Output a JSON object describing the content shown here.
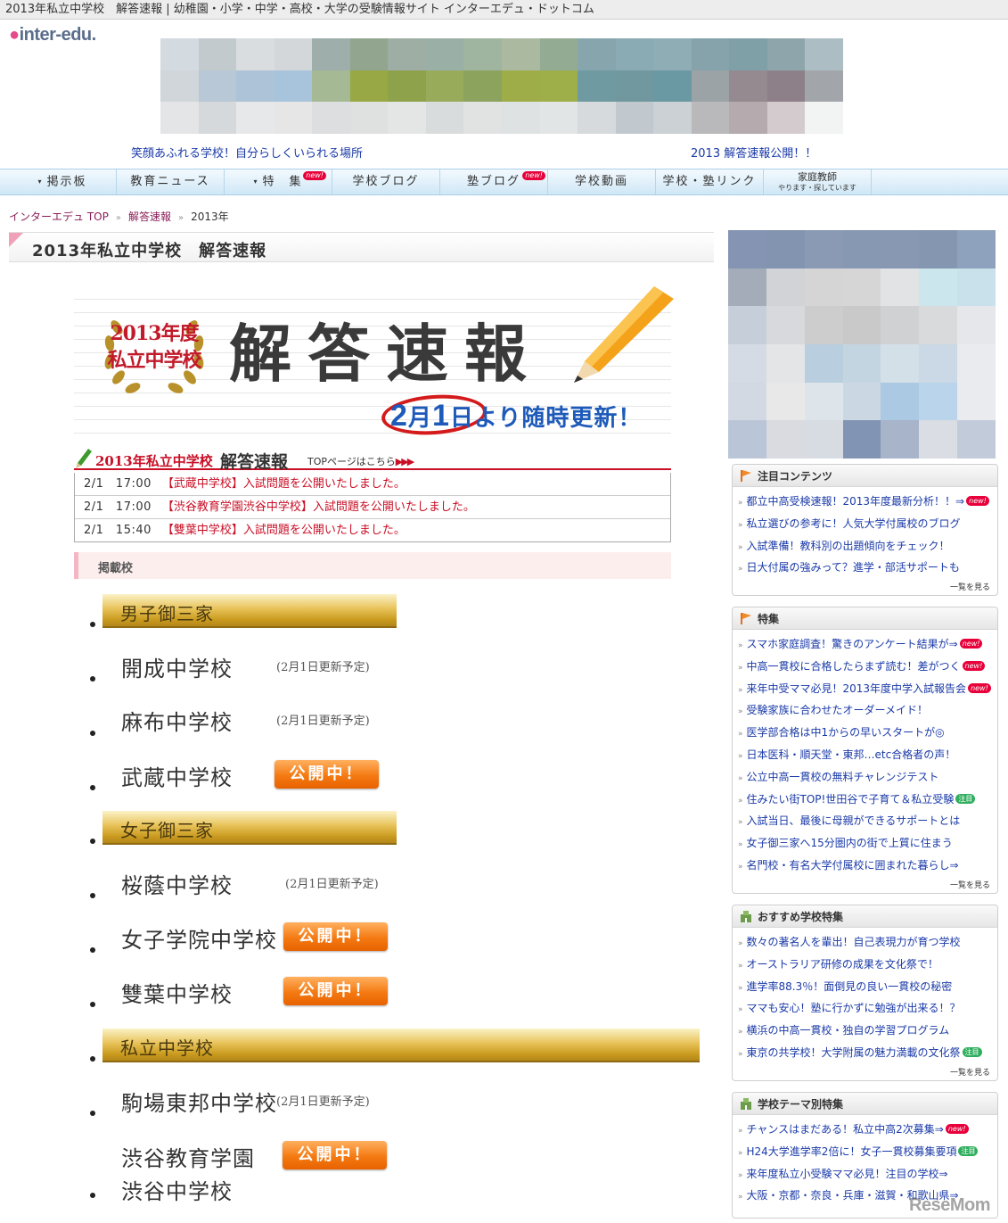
{
  "window": {
    "title": "2013年私立中学校　解答速報 | 幼稚園・小学・中学・高校・大学の受験情報サイト インターエデュ・ドットコム"
  },
  "logo": {
    "text": "inter-edu."
  },
  "banner": {
    "tagline_left": "笑顔あふれる学校！自分らしくいられる場所",
    "tagline_right": "2013 解答速報公開！！",
    "colors": [
      "#d4dbe0",
      "#c3cace",
      "#d9dddf",
      "#d3d7d9",
      "#9eaeab",
      "#92a58f",
      "#9eaea4",
      "#9aafa6",
      "#a0b5a0",
      "#aab9a0",
      "#93aa93",
      "#86a5ad",
      "#8aaab4",
      "#8eadb4",
      "#86a2aa",
      "#7fa0a6",
      "#8ea6ab",
      "#acbec3",
      "#d0d6da",
      "#b8c8d6",
      "#adc3d7",
      "#a8c4dc",
      "#a5b994",
      "#98a844",
      "#8da24a",
      "#98ab5a",
      "#8ba35c",
      "#9ead48",
      "#9eae48",
      "#6f9aa2",
      "#71989e",
      "#6a98a3",
      "#9ba3a6",
      "#948a90",
      "#8e8089",
      "#a2a6ab",
      "#e3e5e6",
      "#d5d9dc",
      "#e6e8ea",
      "#e6e6e6",
      "#dcdee0",
      "#dfe0e0",
      "#e4e5e5",
      "#d9dcdd",
      "#e1e2e2",
      "#dfe2e3",
      "#e2e5e6",
      "#d6dadc",
      "#c1c9cf",
      "#cbd1d4",
      "#b9b8bb",
      "#b5aaae",
      "#d4cbce",
      "#f2f3f3"
    ]
  },
  "nav": {
    "items": [
      {
        "label": "掲示板",
        "arrow": "▾",
        "badge": ""
      },
      {
        "label": "教育ニュース",
        "arrow": "",
        "badge": ""
      },
      {
        "label": "特　集",
        "arrow": "▾",
        "badge": "new!"
      },
      {
        "label": "学校ブログ",
        "arrow": "",
        "badge": ""
      },
      {
        "label": "塾ブログ",
        "arrow": "",
        "badge": "new!"
      },
      {
        "label": "学校動画",
        "arrow": "",
        "badge": ""
      },
      {
        "label": "学校・塾リンク",
        "arrow": "",
        "badge": ""
      }
    ],
    "tutor": {
      "label": "家庭教師",
      "sub": "やります・探しています"
    }
  },
  "breadcrumb": {
    "items": [
      "インターエデュ TOP",
      "解答速報",
      "2013年"
    ],
    "sep": "»"
  },
  "page": {
    "title": "2013年私立中学校　解答速報"
  },
  "hero": {
    "badge_line1": "2013年度",
    "badge_line2": "私立中学校",
    "title": "解答速報",
    "update_date": "2月1日",
    "update_big1": "2",
    "update_mid": "月",
    "update_big2": "1",
    "update_end": "日",
    "update_text": "より随時更新！"
  },
  "news": {
    "head_red": "2013年私立中学校",
    "head_black": "解答速報",
    "top_link": "TOPページはこちら",
    "top_arrows": "▶▶▶",
    "rows": [
      {
        "date": "2/1　17:00",
        "text": "【武蔵中学校】入試問題を公開いたしました。"
      },
      {
        "date": "2/1　17:00",
        "text": "【渋谷教育学園渋谷中学校】入試問題を公開いたしました。"
      },
      {
        "date": "2/1　15:40",
        "text": "【雙葉中学校】入試問題を公開いたしました。"
      }
    ]
  },
  "schools_section": {
    "label": "掲載校"
  },
  "categories": [
    {
      "label": "男子御三家"
    },
    {
      "label": "女子御三家"
    },
    {
      "label": "私立中学校"
    }
  ],
  "schools": [
    {
      "name": "開成中学校",
      "status": "(2月1日更新予定)"
    },
    {
      "name": "麻布中学校",
      "status": "(2月1日更新予定)"
    },
    {
      "name": "武蔵中学校",
      "status": "公開中！"
    },
    {
      "name": "桜蔭中学校",
      "status": "(2月1日更新予定)"
    },
    {
      "name": "女子学院中学校",
      "status": "公開中！"
    },
    {
      "name": "雙葉中学校",
      "status": "公開中！"
    },
    {
      "name": "駒場東邦中学校",
      "status": "(2月1日更新予定)"
    },
    {
      "name": "渋谷教育学園",
      "name2": "渋谷中学校",
      "status": "公開中！"
    }
  ],
  "side_ad": {
    "colors": [
      "#8494b2",
      "#8394b0",
      "#8a9ab5",
      "#8798b3",
      "#8898b3",
      "#8596b1",
      "#8fa2bd",
      "#a5acb9",
      "#d2d3d6",
      "#d5d5d6",
      "#d6d6d7",
      "#e1e3e4",
      "#cbe6ec",
      "#c8e1ea",
      "#c6ced9",
      "#d8d9dc",
      "#cdcdce",
      "#c9c9ca",
      "#d0d1d2",
      "#d9dadc",
      "#e6e7ea",
      "#d5dbe4",
      "#e4e5e6",
      "#b9cfdf",
      "#c4d5e2",
      "#d3e0e8",
      "#cad9e5",
      "#e9ebee",
      "#d2d9e3",
      "#e8e8e9",
      "#dde4ea",
      "#cbd8e4",
      "#abc9e2",
      "#b9d4eb",
      "#eaebee",
      "#bac6d8",
      "#d9dbe1",
      "#d7dce3",
      "#8294b4",
      "#a7b4c9",
      "#dadde4",
      "#c2cbda"
    ]
  },
  "panels": [
    {
      "title": "注目コンテンツ",
      "more": "一覧を見る",
      "items": [
        {
          "text": "都立中高受検速報！2013年度最新分析！！⇒",
          "badge": "new!"
        },
        {
          "text": "私立選びの参考に！人気大学付属校のブログ",
          "badge": ""
        },
        {
          "text": "入試準備！教科別の出題傾向をチェック！",
          "badge": ""
        },
        {
          "text": "日大付属の強みって？進学・部活サポートも",
          "badge": ""
        }
      ]
    },
    {
      "title": "特集",
      "more": "一覧を見る",
      "items": [
        {
          "text": "スマホ家庭調査！驚きのアンケート結果が⇒",
          "badge": "new!"
        },
        {
          "text": "中高一貫校に合格したらまず読む！差がつく",
          "badge": "new!"
        },
        {
          "text": "来年中受ママ必見！2013年度中学入試報告会",
          "badge": "new!"
        },
        {
          "text": "受験家族に合わせたオーダーメイド！",
          "badge": ""
        },
        {
          "text": "医学部合格は中1からの早いスタートが◎",
          "badge": ""
        },
        {
          "text": "日本医科・順天堂・東邦…etc合格者の声！",
          "badge": ""
        },
        {
          "text": "公立中高一貫校の無料チャレンジテスト",
          "badge": ""
        },
        {
          "text": "住みたい街TOP!世田谷で子育て＆私立受験",
          "badge": "注目"
        },
        {
          "text": "入試当日、最後に母親ができるサポートとは",
          "badge": ""
        },
        {
          "text": "女子御三家へ15分圏内の街で上質に住まう",
          "badge": ""
        },
        {
          "text": "名門校・有名大学付属校に囲まれた暮らし⇒",
          "badge": ""
        }
      ]
    },
    {
      "title": "おすすめ学校特集",
      "more": "一覧を見る",
      "items": [
        {
          "text": "数々の著名人を輩出！自己表現力が育つ学校",
          "badge": ""
        },
        {
          "text": "オーストラリア研修の成果を文化祭で！",
          "badge": ""
        },
        {
          "text": "進学率88.3％！面倒見の良い一貫校の秘密",
          "badge": ""
        },
        {
          "text": "ママも安心！塾に行かずに勉強が出来る！？",
          "badge": ""
        },
        {
          "text": "横浜の中高一貫校・独自の学習プログラム",
          "badge": ""
        },
        {
          "text": "東京の共学校！大学附属の魅力満載の文化祭",
          "badge": "注目"
        }
      ]
    },
    {
      "title": "学校テーマ別特集",
      "more": "",
      "items": [
        {
          "text": "チャンスはまだある！私立中高2次募集⇒",
          "badge": "new!"
        },
        {
          "text": "H24大学進学率2倍に！女子一貫校募集要項",
          "badge": "注目"
        },
        {
          "text": "来年度私立小受験ママ必見！注目の学校⇒",
          "badge": ""
        },
        {
          "text": "大阪・京都・奈良・兵庫・滋賀・和歌山県⇒",
          "badge": ""
        }
      ]
    }
  ],
  "watermark": {
    "text": "ReseMom"
  }
}
